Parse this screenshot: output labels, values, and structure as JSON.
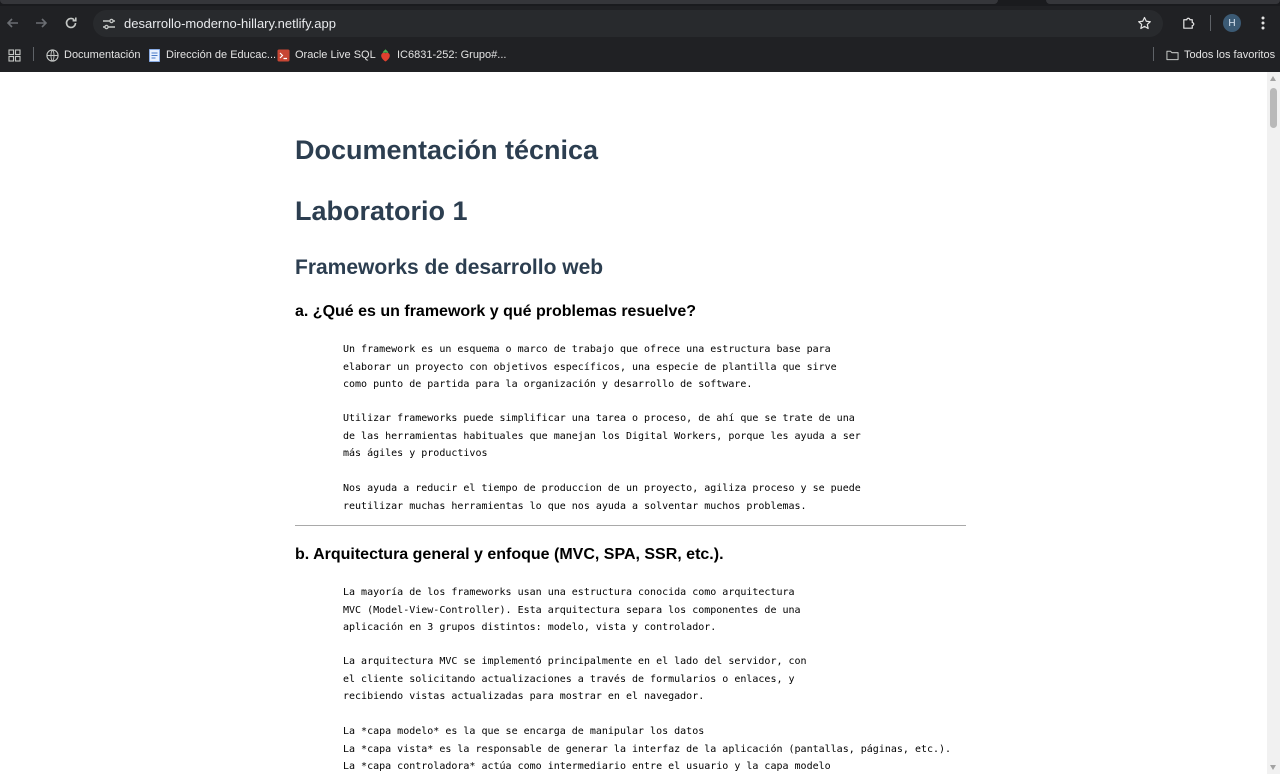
{
  "browser": {
    "url": "desarrollo-moderno-hillary.netlify.app",
    "profile_initial": "H",
    "bookmarks": [
      {
        "label": "Documentación",
        "icon": "globe-icon"
      },
      {
        "label": "Dirección de Educac...",
        "icon": "document-icon"
      },
      {
        "label": "Oracle Live SQL",
        "icon": "terminal-icon"
      },
      {
        "label": "IC6831-252: Grupo#...",
        "icon": "strawberry-icon"
      }
    ],
    "all_bookmarks_label": "Todos los favoritos"
  },
  "page": {
    "title": "Documentación técnica",
    "lab_title": "Laboratorio 1",
    "section_title": "Frameworks de desarrollo web",
    "q_a": {
      "heading": "a. ¿Qué es un framework y qué problemas resuelve?",
      "paragraphs": [
        "Un framework es un esquema o marco de trabajo que ofrece una estructura base para\nelaborar un proyecto con objetivos específicos, una especie de plantilla que sirve\ncomo punto de partida para la organización y desarrollo de software.",
        "Utilizar frameworks puede simplificar una tarea o proceso, de ahí que se trate de una\nde las herramientas habituales que manejan los Digital Workers, porque les ayuda a ser\nmás ágiles y productivos",
        "Nos ayuda a reducir el tiempo de produccion de un proyecto, agiliza proceso y se puede\nreutilizar muchas herramientas lo que nos ayuda a solventar muchos problemas."
      ]
    },
    "q_b": {
      "heading": "b. Arquitectura general y enfoque (MVC, SPA, SSR, etc.).",
      "paragraphs": [
        "La mayoría de los frameworks usan una estructura conocida como arquitectura\nMVC (Model-View-Controller). Esta arquitectura separa los componentes de una\naplicación en 3 grupos distintos: modelo, vista y controlador.",
        "La arquitectura MVC se implementó principalmente en el lado del servidor, con\nel cliente solicitando actualizaciones a través de formularios o enlaces, y\nrecibiendo vistas actualizadas para mostrar en el navegador.",
        "La *capa modelo* es la que se encarga de manipular los datos\nLa *capa vista* es la responsable de generar la interfaz de la aplicación (pantallas, páginas, etc.).\nLa *capa controladora* actúa como intermediario entre el usuario y la capa modelo"
      ]
    }
  }
}
